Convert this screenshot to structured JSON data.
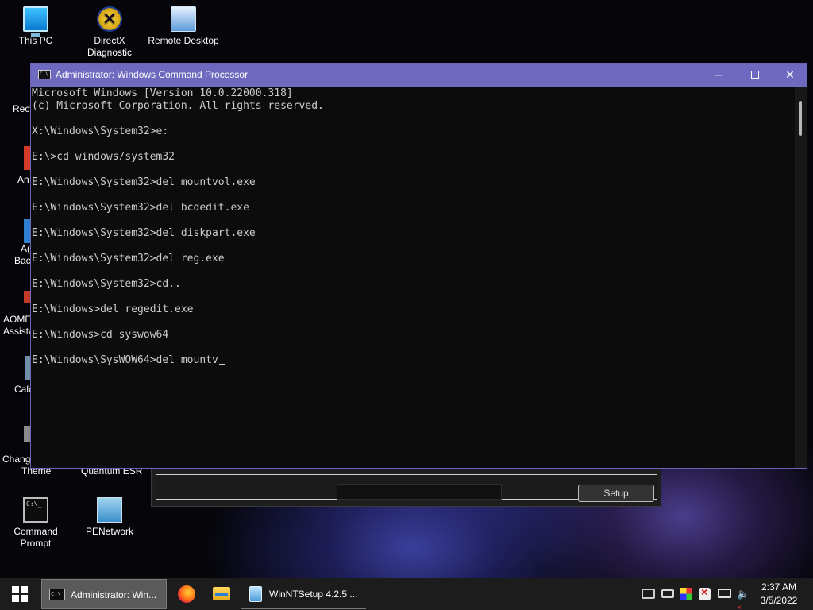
{
  "desktop": {
    "icons": [
      {
        "label": "This PC"
      },
      {
        "label": "DirectX Diagnostic"
      },
      {
        "label": "Remote Desktop"
      },
      {
        "label": "Command Prompt"
      },
      {
        "label": "PENetwork"
      }
    ],
    "partial_labels": {
      "recycle": "Recy",
      "an": "An",
      "aom_a": "A(",
      "aom_b": "Bac",
      "aomei_a": "AOME",
      "aomei_b": "Assista",
      "calc": "Calc",
      "change_a": "Change",
      "change_b": "Theme",
      "quantum": "Quantum ESR"
    }
  },
  "cmd_window": {
    "title": "Administrator: Windows Command Processor",
    "icon": "cmd-icon",
    "controls": {
      "minimize": "─",
      "close": "✕"
    },
    "lines": [
      "Microsoft Windows [Version 10.0.22000.318]",
      "(c) Microsoft Corporation. All rights reserved.",
      "",
      "X:\\Windows\\System32>e:",
      "",
      "E:\\>cd windows/system32",
      "",
      "E:\\Windows\\System32>del mountvol.exe",
      "",
      "E:\\Windows\\System32>del bcdedit.exe",
      "",
      "E:\\Windows\\System32>del diskpart.exe",
      "",
      "E:\\Windows\\System32>del reg.exe",
      "",
      "E:\\Windows\\System32>cd..",
      "",
      "E:\\Windows>del regedit.exe",
      "",
      "E:\\Windows>cd syswow64",
      "",
      "E:\\Windows\\SysWOW64>del mountv"
    ]
  },
  "winntsetup": {
    "setup_label": "Setup"
  },
  "taskbar": {
    "start_icon": "windows-logo-icon",
    "items": [
      {
        "label": "Administrator: Win...",
        "icon": "cmd-icon"
      },
      {
        "label": "",
        "icon": "firefox-icon"
      },
      {
        "label": "",
        "icon": "file-explorer-icon"
      },
      {
        "label": "WinNTSetup 4.2.5   ...",
        "icon": "winntsetup-icon"
      }
    ],
    "tray": {
      "volume_glyph": "🔈",
      "volume_mute": "×"
    },
    "clock": {
      "time": "2:37 AM",
      "date": "3/5/2022"
    }
  }
}
